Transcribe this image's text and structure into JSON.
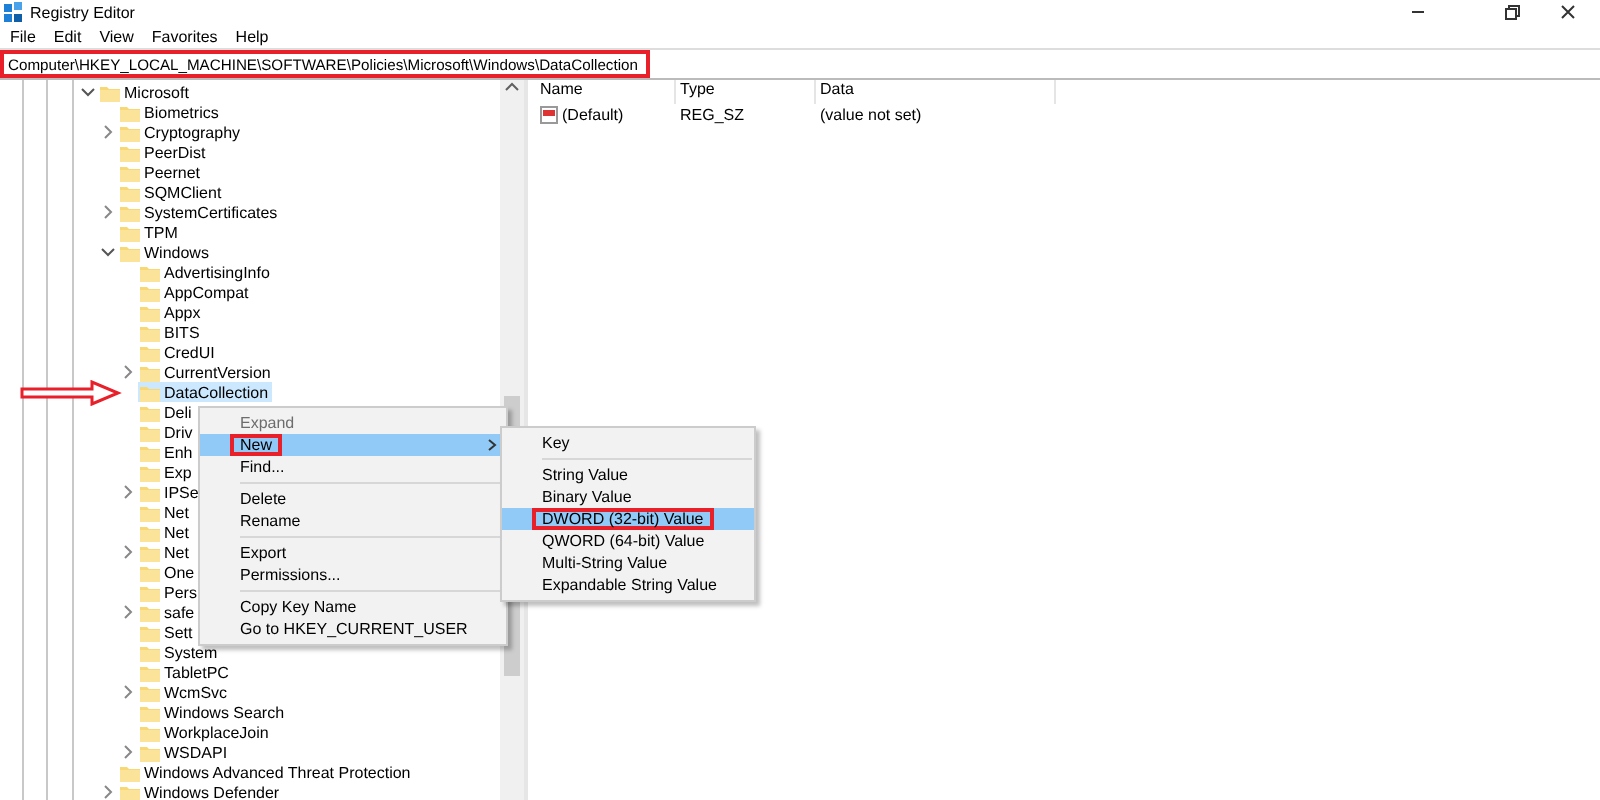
{
  "window": {
    "title": "Registry Editor"
  },
  "menu_bar": [
    "File",
    "Edit",
    "View",
    "Favorites",
    "Help"
  ],
  "address_bar": {
    "value": "Computer\\HKEY_LOCAL_MACHINE\\SOFTWARE\\Policies\\Microsoft\\Windows\\DataCollection",
    "marked": true
  },
  "tree": [
    {
      "label": "Microsoft",
      "expandable": true,
      "expanded": true,
      "selected": false,
      "pointed": false,
      "children": [
        {
          "label": "Biometrics",
          "expandable": false,
          "expanded": false,
          "selected": false,
          "pointed": false
        },
        {
          "label": "Cryptography",
          "expandable": true,
          "expanded": false,
          "selected": false,
          "pointed": false
        },
        {
          "label": "PeerDist",
          "expandable": false,
          "expanded": false,
          "selected": false,
          "pointed": false
        },
        {
          "label": "Peernet",
          "expandable": false,
          "expanded": false,
          "selected": false,
          "pointed": false
        },
        {
          "label": "SQMClient",
          "expandable": false,
          "expanded": false,
          "selected": false,
          "pointed": false
        },
        {
          "label": "SystemCertificates",
          "expandable": true,
          "expanded": false,
          "selected": false,
          "pointed": false
        },
        {
          "label": "TPM",
          "expandable": false,
          "expanded": false,
          "selected": false,
          "pointed": false
        },
        {
          "label": "Windows",
          "expandable": true,
          "expanded": true,
          "selected": false,
          "pointed": false,
          "children": [
            {
              "label": "AdvertisingInfo",
              "expandable": false,
              "expanded": false,
              "selected": false,
              "pointed": false
            },
            {
              "label": "AppCompat",
              "expandable": false,
              "expanded": false,
              "selected": false,
              "pointed": false
            },
            {
              "label": "Appx",
              "expandable": false,
              "expanded": false,
              "selected": false,
              "pointed": false
            },
            {
              "label": "BITS",
              "expandable": false,
              "expanded": false,
              "selected": false,
              "pointed": false
            },
            {
              "label": "CredUI",
              "expandable": false,
              "expanded": false,
              "selected": false,
              "pointed": false
            },
            {
              "label": "CurrentVersion",
              "expandable": true,
              "expanded": false,
              "selected": false,
              "pointed": false
            },
            {
              "label": "DataCollection",
              "expandable": false,
              "expanded": false,
              "selected": true,
              "pointed": true
            },
            {
              "label": "Deli",
              "expandable": false,
              "expanded": false,
              "selected": false,
              "pointed": false
            },
            {
              "label": "Driv",
              "expandable": false,
              "expanded": false,
              "selected": false,
              "pointed": false
            },
            {
              "label": "Enh",
              "expandable": false,
              "expanded": false,
              "selected": false,
              "pointed": false
            },
            {
              "label": "Exp",
              "expandable": false,
              "expanded": false,
              "selected": false,
              "pointed": false
            },
            {
              "label": "IPSe",
              "expandable": true,
              "expanded": false,
              "selected": false,
              "pointed": false
            },
            {
              "label": "Net",
              "expandable": false,
              "expanded": false,
              "selected": false,
              "pointed": false
            },
            {
              "label": "Net",
              "expandable": false,
              "expanded": false,
              "selected": false,
              "pointed": false
            },
            {
              "label": "Net",
              "expandable": true,
              "expanded": false,
              "selected": false,
              "pointed": false
            },
            {
              "label": "One",
              "expandable": false,
              "expanded": false,
              "selected": false,
              "pointed": false
            },
            {
              "label": "Pers",
              "expandable": false,
              "expanded": false,
              "selected": false,
              "pointed": false
            },
            {
              "label": "safe",
              "expandable": true,
              "expanded": false,
              "selected": false,
              "pointed": false
            },
            {
              "label": "Sett",
              "expandable": false,
              "expanded": false,
              "selected": false,
              "pointed": false
            },
            {
              "label": "System",
              "expandable": false,
              "expanded": false,
              "selected": false,
              "pointed": false
            },
            {
              "label": "TabletPC",
              "expandable": false,
              "expanded": false,
              "selected": false,
              "pointed": false
            },
            {
              "label": "WcmSvc",
              "expandable": true,
              "expanded": false,
              "selected": false,
              "pointed": false
            },
            {
              "label": "Windows Search",
              "expandable": false,
              "expanded": false,
              "selected": false,
              "pointed": false
            },
            {
              "label": "WorkplaceJoin",
              "expandable": false,
              "expanded": false,
              "selected": false,
              "pointed": false
            },
            {
              "label": "WSDAPI",
              "expandable": true,
              "expanded": false,
              "selected": false,
              "pointed": false
            }
          ]
        },
        {
          "label": "Windows Advanced Threat Protection",
          "expandable": false,
          "expanded": false,
          "selected": false,
          "pointed": false
        },
        {
          "label": "Windows Defender",
          "expandable": true,
          "expanded": false,
          "selected": false,
          "pointed": false
        }
      ]
    }
  ],
  "values_pane": {
    "columns": [
      "Name",
      "Type",
      "Data"
    ],
    "rows": [
      {
        "name": "(Default)",
        "type": "REG_SZ",
        "data": "(value not set)"
      }
    ]
  },
  "context_menu": {
    "items": [
      {
        "kind": "item",
        "label": "Expand",
        "selected": false,
        "disabled": true,
        "marked": false
      },
      {
        "kind": "item",
        "label": "New",
        "selected": true,
        "disabled": false,
        "marked": true,
        "children": [
          {
            "kind": "item",
            "label": "Key",
            "selected": false,
            "disabled": false,
            "marked": false
          },
          {
            "kind": "separator"
          },
          {
            "kind": "item",
            "label": "String Value",
            "selected": false,
            "disabled": false,
            "marked": false
          },
          {
            "kind": "item",
            "label": "Binary Value",
            "selected": false,
            "disabled": false,
            "marked": false
          },
          {
            "kind": "item",
            "label": "DWORD (32-bit) Value",
            "selected": true,
            "disabled": false,
            "marked": true
          },
          {
            "kind": "item",
            "label": "QWORD (64-bit) Value",
            "selected": false,
            "disabled": false,
            "marked": false
          },
          {
            "kind": "item",
            "label": "Multi-String Value",
            "selected": false,
            "disabled": false,
            "marked": false
          },
          {
            "kind": "item",
            "label": "Expandable String Value",
            "selected": false,
            "disabled": false,
            "marked": false
          }
        ]
      },
      {
        "kind": "item",
        "label": "Find...",
        "selected": false,
        "disabled": false,
        "marked": false
      },
      {
        "kind": "separator"
      },
      {
        "kind": "item",
        "label": "Delete",
        "selected": false,
        "disabled": false,
        "marked": false
      },
      {
        "kind": "item",
        "label": "Rename",
        "selected": false,
        "disabled": false,
        "marked": false
      },
      {
        "kind": "separator"
      },
      {
        "kind": "item",
        "label": "Export",
        "selected": false,
        "disabled": false,
        "marked": false
      },
      {
        "kind": "item",
        "label": "Permissions...",
        "selected": false,
        "disabled": false,
        "marked": false
      },
      {
        "kind": "separator"
      },
      {
        "kind": "item",
        "label": "Copy Key Name",
        "selected": false,
        "disabled": false,
        "marked": false
      },
      {
        "kind": "item",
        "label": "Go to HKEY_CURRENT_USER",
        "selected": false,
        "disabled": false,
        "marked": false
      }
    ]
  }
}
